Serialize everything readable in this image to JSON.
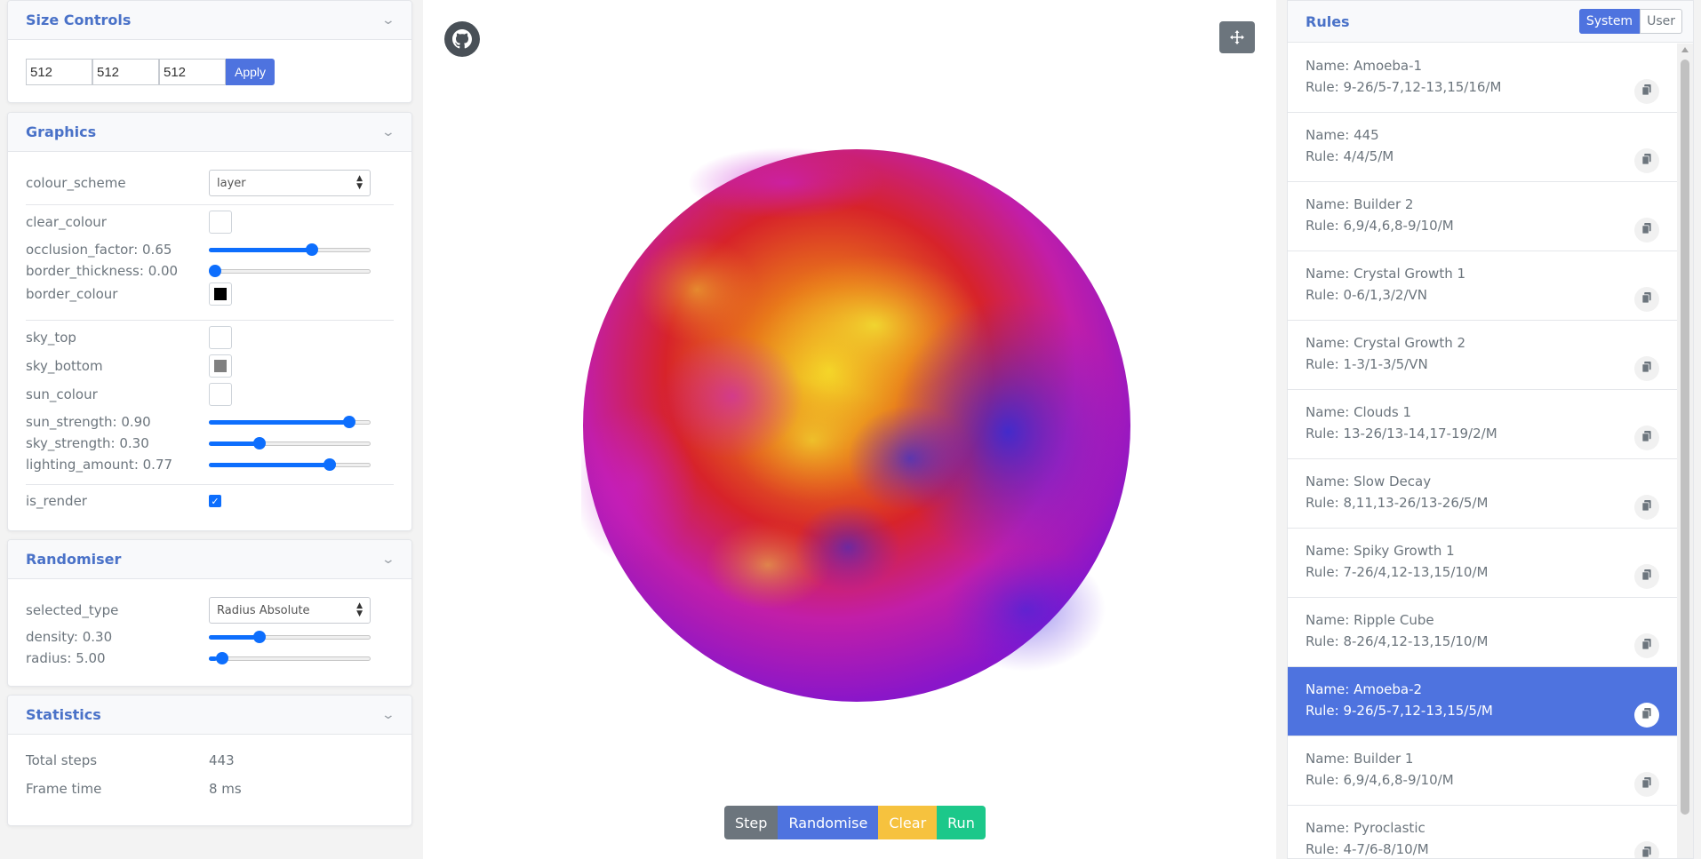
{
  "size_controls": {
    "title": "Size Controls",
    "x": "512",
    "y": "512",
    "z": "512",
    "apply_label": "Apply"
  },
  "graphics": {
    "title": "Graphics",
    "colour_scheme_label": "colour_scheme",
    "colour_scheme_value": "layer",
    "clear_colour_label": "clear_colour",
    "clear_colour": "#ffffff",
    "occlusion_label": "occlusion_factor: 0.65",
    "occlusion_value": 0.65,
    "border_thickness_label": "border_thickness: 0.00",
    "border_thickness_value": 0.0,
    "border_colour_label": "border_colour",
    "border_colour": "#000000",
    "sky_top_label": "sky_top",
    "sky_top": "#ffffff",
    "sky_bottom_label": "sky_bottom",
    "sky_bottom": "#808080",
    "sun_colour_label": "sun_colour",
    "sun_colour": "#ffffff",
    "sun_strength_label": "sun_strength: 0.90",
    "sun_strength_value": 0.9,
    "sky_strength_label": "sky_strength: 0.30",
    "sky_strength_value": 0.3,
    "lighting_label": "lighting_amount: 0.77",
    "lighting_value": 0.77,
    "is_render_label": "is_render",
    "is_render": true
  },
  "randomiser": {
    "title": "Randomiser",
    "selected_type_label": "selected_type",
    "selected_type_value": "Radius Absolute",
    "density_label": "density: 0.30",
    "density_value": 0.3,
    "radius_label": "radius: 5.00",
    "radius_value": 0.05
  },
  "statistics": {
    "title": "Statistics",
    "total_steps_label": "Total steps",
    "total_steps_value": "443",
    "frame_time_label": "Frame time",
    "frame_time_value": "8 ms"
  },
  "controls": {
    "step": "Step",
    "randomise": "Randomise",
    "clear": "Clear",
    "run": "Run"
  },
  "rules": {
    "title": "Rules",
    "system_label": "System",
    "user_label": "User",
    "items": [
      {
        "name": "Name: Amoeba-1",
        "rule": "Rule: 9-26/5-7,12-13,15/16/M",
        "active": false
      },
      {
        "name": "Name: 445",
        "rule": "Rule: 4/4/5/M",
        "active": false
      },
      {
        "name": "Name: Builder 2",
        "rule": "Rule: 6,9/4,6,8-9/10/M",
        "active": false
      },
      {
        "name": "Name: Crystal Growth 1",
        "rule": "Rule: 0-6/1,3/2/VN",
        "active": false
      },
      {
        "name": "Name: Crystal Growth 2",
        "rule": "Rule: 1-3/1-3/5/VN",
        "active": false
      },
      {
        "name": "Name: Clouds 1",
        "rule": "Rule: 13-26/13-14,17-19/2/M",
        "active": false
      },
      {
        "name": "Name: Slow Decay",
        "rule": "Rule: 8,11,13-26/13-26/5/M",
        "active": false
      },
      {
        "name": "Name: Spiky Growth 1",
        "rule": "Rule: 7-26/4,12-13,15/10/M",
        "active": false
      },
      {
        "name": "Name: Ripple Cube",
        "rule": "Rule: 8-26/4,12-13,15/10/M",
        "active": false
      },
      {
        "name": "Name: Amoeba-2",
        "rule": "Rule: 9-26/5-7,12-13,15/5/M",
        "active": true
      },
      {
        "name": "Name: Builder 1",
        "rule": "Rule: 6,9/4,6,8-9/10/M",
        "active": false
      },
      {
        "name": "Name: Pyroclastic",
        "rule": "Rule: 4-7/6-8/10/M",
        "active": false
      }
    ]
  },
  "colors": {
    "accent": "#4e73df",
    "slider": "#0d6efd",
    "step_btn": "#6c757d",
    "randomise_btn": "#4e73df",
    "clear_btn": "#f6c23e",
    "run_btn": "#1cc88a"
  },
  "icons": {
    "github": "github-icon",
    "move": "move-icon",
    "copy": "copy-icon",
    "chevron": "chevron-down-icon"
  }
}
